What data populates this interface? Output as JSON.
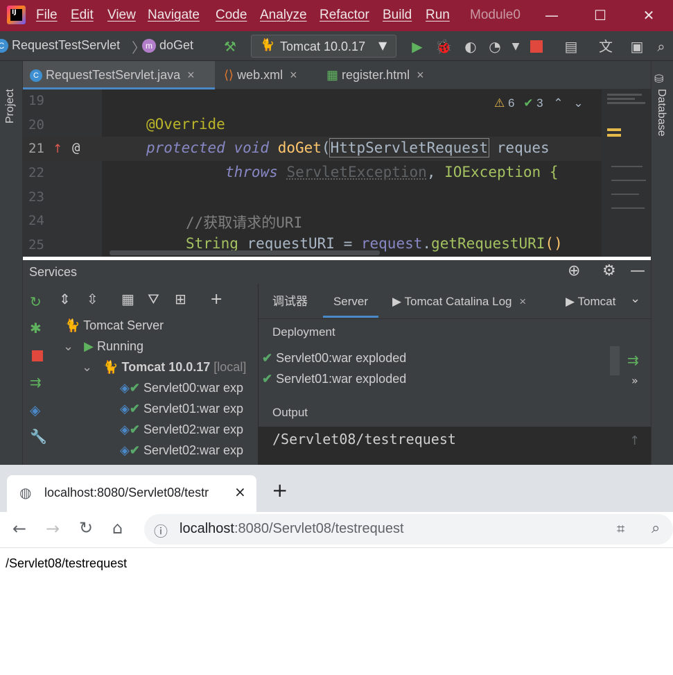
{
  "menubar": {
    "items": [
      "File",
      "Edit",
      "View",
      "Navigate",
      "Code",
      "Analyze",
      "Refactor",
      "Build",
      "Run"
    ],
    "project_name": "Module0",
    "colors": {
      "bar": "#8f1e36"
    }
  },
  "breadcrumb": {
    "class_name": "RequestTestServlet",
    "method_name": "doGet",
    "class_icon_letter": "C",
    "method_icon_letter": "m"
  },
  "run_config": {
    "label": "Tomcat 10.0.17"
  },
  "left_stripe": {
    "project_label": "Project"
  },
  "right_stripe": {
    "database_label": "Database"
  },
  "editor_tabs": [
    {
      "label": "RequestTestServlet.java",
      "close": "×"
    },
    {
      "label": "web.xml",
      "close": "×"
    },
    {
      "label": "register.html",
      "close": "×"
    }
  ],
  "inspections": {
    "warnings": "6",
    "weak_warnings": "3"
  },
  "code": {
    "line_numbers": [
      "19",
      "20",
      "21",
      "22",
      "23",
      "24",
      "25"
    ],
    "annotation": "@Override",
    "line21": {
      "kw1": "protected",
      "kw2": "void",
      "fn": "doGet",
      "open": "(",
      "param_type": "HttpServletRequest",
      "param_rest": " reques"
    },
    "line22": {
      "kw": "throws",
      "ex1": "ServletException",
      "sep": ", ",
      "ex2": "IOException",
      "brace": " {"
    },
    "comment": "//获取请求的URI",
    "line25": {
      "type": "String",
      "var": " requestURI ",
      "eq": "=",
      "obj": " request",
      "dot": ".",
      "call": "getRequestURI",
      "paren": "()"
    },
    "gutter_at": "@"
  },
  "services": {
    "title": "Services",
    "tree": {
      "root": "Tomcat Server",
      "state": "Running",
      "server_name": "Tomcat 10.0.17",
      "server_hint": "[local]",
      "artifacts": [
        "Servlet00:war exp",
        "Servlet01:war exp",
        "Servlet02:war exp",
        "Servlet02:war exp"
      ]
    },
    "tabs": [
      {
        "label": "调试器"
      },
      {
        "label": "Server",
        "active": true
      },
      {
        "label": "Tomcat Catalina Log",
        "close": "×"
      },
      {
        "label": "Tomcat"
      }
    ],
    "deployment_label": "Deployment",
    "deployments": [
      "Servlet00:war exploded",
      "Servlet01:war exploded"
    ],
    "more": "»",
    "output_label": "Output",
    "output_text": "/Servlet08/testrequest"
  },
  "browser": {
    "tab_title": "localhost:8080/Servlet08/testr",
    "tab_close": "×",
    "new_tab": "+",
    "url_host": "localhost",
    "url_rest": ":8080/Servlet08/testrequest",
    "page_text": "/Servlet08/testrequest"
  }
}
